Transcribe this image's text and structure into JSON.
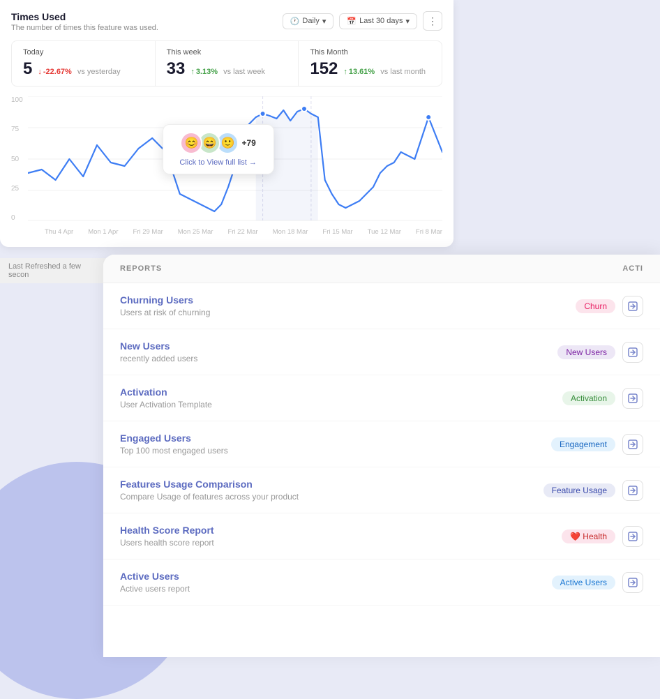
{
  "chart": {
    "title": "Times Used",
    "subtitle": "The number of times this feature was used.",
    "controls": {
      "daily_label": "Daily",
      "range_label": "Last 30 days"
    },
    "stats": {
      "today": {
        "label": "Today",
        "value": "5",
        "change": "-22.67%",
        "change_direction": "down",
        "vs": "vs yesterday"
      },
      "this_week": {
        "label": "This week",
        "value": "33",
        "change": "3.13%",
        "change_direction": "up",
        "vs": "vs last week"
      },
      "this_month": {
        "label": "This Month",
        "value": "152",
        "change": "13.61%",
        "change_direction": "up",
        "vs": "vs last month"
      }
    },
    "tooltip": {
      "count_label": "+79",
      "link_label": "Click to View full list →"
    },
    "y_labels": [
      "100",
      "75",
      "50",
      "25",
      "0"
    ],
    "x_labels": [
      "Thu 4 Apr",
      "Mon 1 Apr",
      "Fri 29 Mar",
      "Mon 25 Mar",
      "Fri 22 Mar",
      "Mon 18 Mar",
      "Fri 15 Mar",
      "Tue 12 Mar",
      "Fri 8 Mar"
    ]
  },
  "refresh": {
    "label": "Last Refreshed a few secon"
  },
  "reports": {
    "section_title": "REPORTS",
    "actions_header": "ACTI",
    "items": [
      {
        "id": "churning-users",
        "name": "Churning Users",
        "description": "Users at risk of churning",
        "tag": "Churn",
        "tag_class": "tag-churn"
      },
      {
        "id": "new-users",
        "name": "New Users",
        "description": "recently added users",
        "tag": "New Users",
        "tag_class": "tag-new-users"
      },
      {
        "id": "activation",
        "name": "Activation",
        "description": "User Activation Template",
        "tag": "Activation",
        "tag_class": "tag-activation"
      },
      {
        "id": "engaged-users",
        "name": "Engaged Users",
        "description": "Top 100 most engaged users",
        "tag": "Engagement",
        "tag_class": "tag-engagement"
      },
      {
        "id": "features-usage",
        "name": "Features Usage Comparison",
        "description": "Compare Usage of features across your product",
        "tag": "Feature Usage",
        "tag_class": "tag-feature"
      },
      {
        "id": "health-score",
        "name": "Health Score Report",
        "description": "Users health score report",
        "tag": "Health",
        "tag_class": "tag-health",
        "has_heart": true
      },
      {
        "id": "active-users",
        "name": "Active Users",
        "description": "Active users report",
        "tag": "Active Users",
        "tag_class": "tag-active"
      }
    ]
  }
}
